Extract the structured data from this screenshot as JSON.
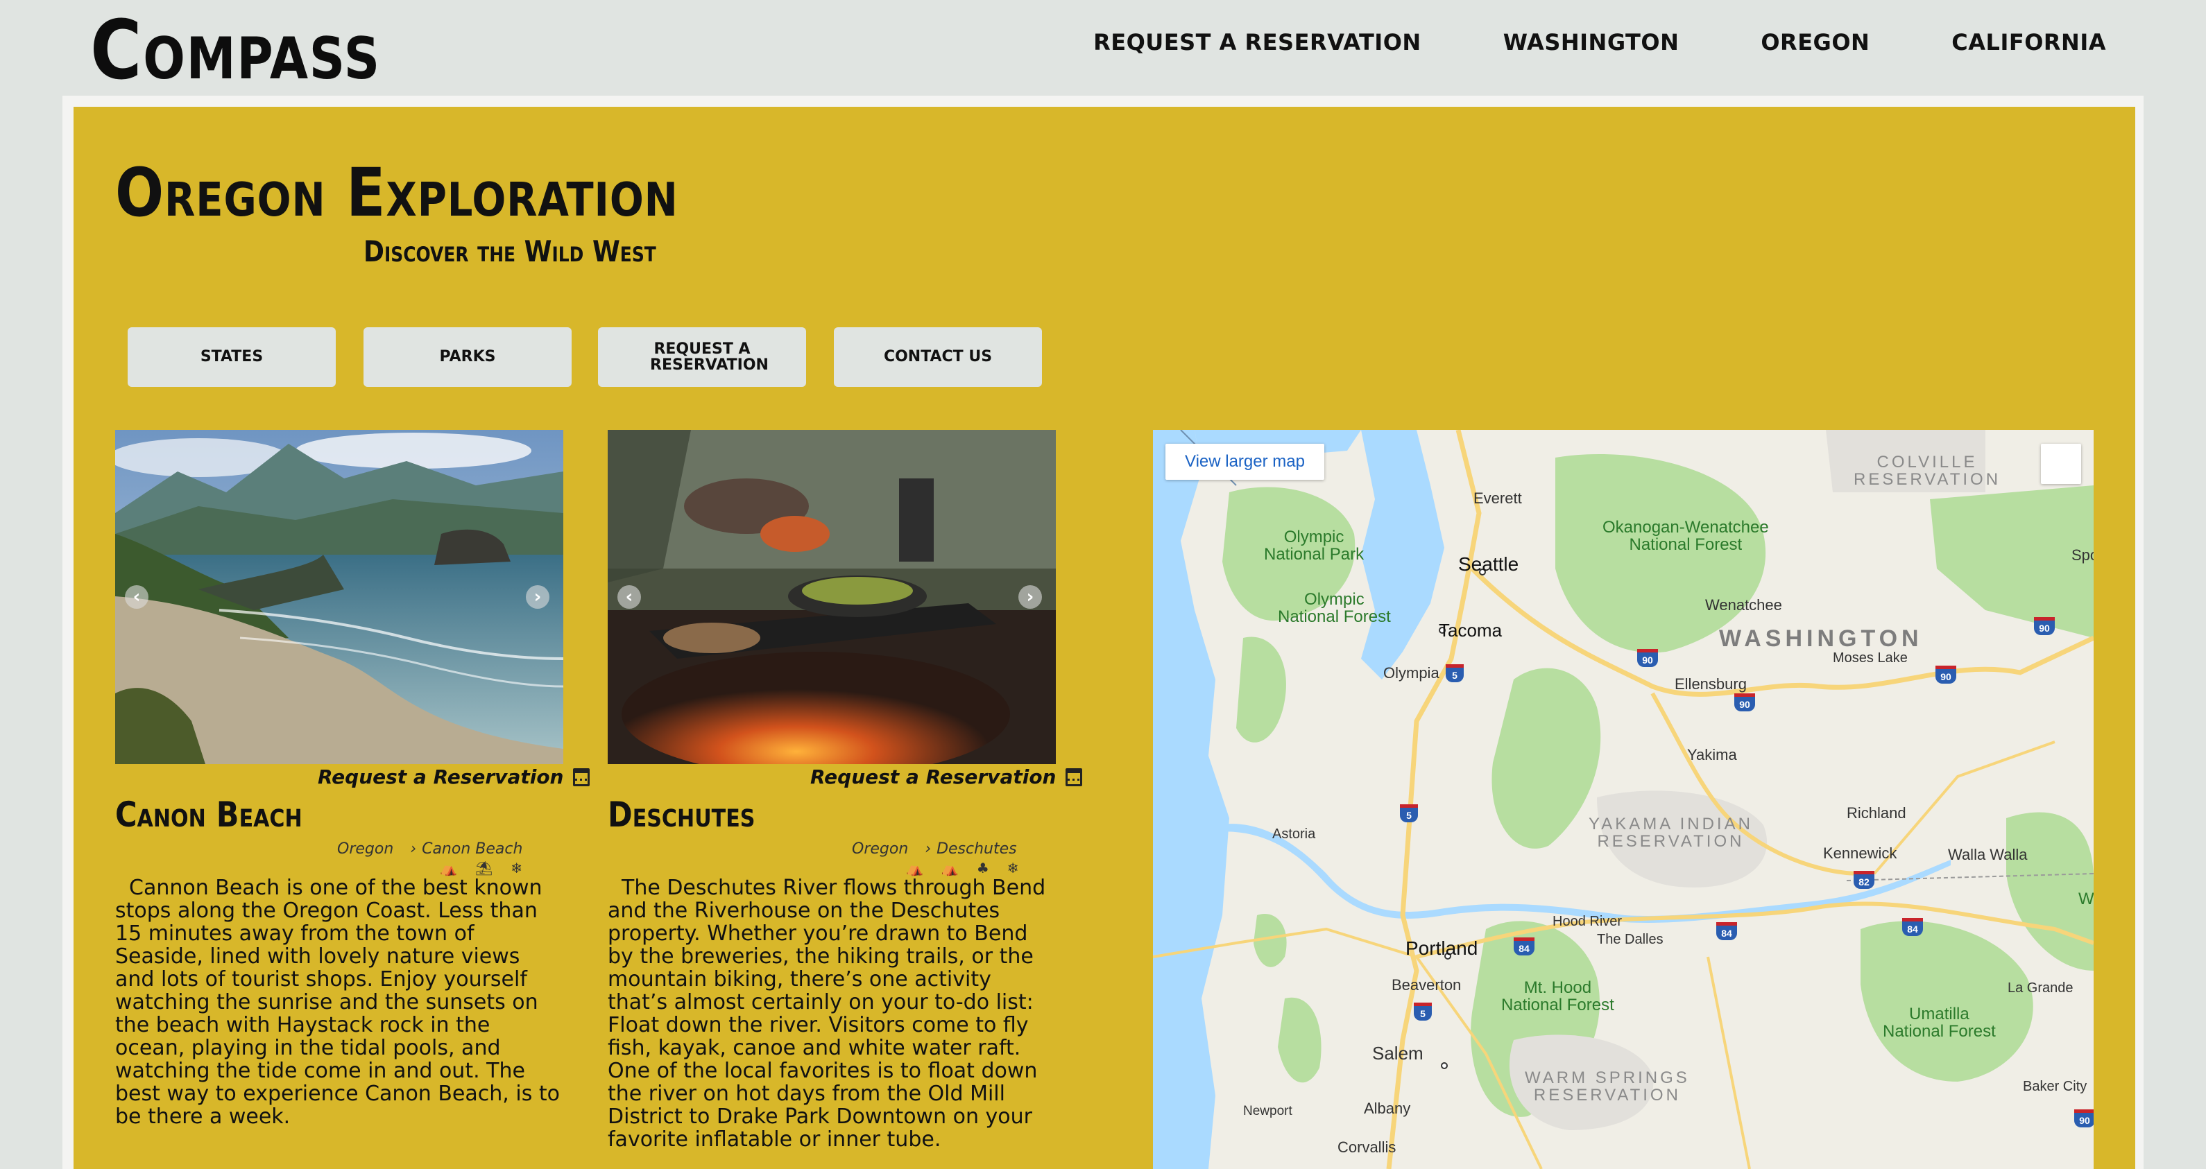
{
  "header": {
    "logo": "Compass",
    "nav": [
      "REQUEST A RESERVATION",
      "WASHINGTON",
      "OREGON",
      "CALIFORNIA"
    ]
  },
  "hero": {
    "title": "Oregon Exploration",
    "subtitle": "Discover the Wild West"
  },
  "buttons": [
    "STATES",
    "PARKS",
    "REQUEST A RESERVATION",
    "CONTACT US"
  ],
  "cards": [
    {
      "reserve_label": "Request a Reservation",
      "title": "Canon Beach",
      "crumb_state": "Oregon",
      "crumb_place": "Canon Beach",
      "amenities": [
        "tent-icon",
        "beach-umbrella-icon",
        "snowflake-icon"
      ],
      "description": "Cannon Beach is one of the best known stops along the Oregon Coast. Less than 15 minutes away from the town of Seaside, lined with lovely nature views and lots of tourist shops. Enjoy yourself watching the sunrise and the sunsets on the beach with Haystack rock in the ocean, playing in the tidal pools, and watching the tide come in and out. The best way to experience Canon Beach, is to be there a week."
    },
    {
      "reserve_label": "Request a Reservation",
      "title": "Deschutes",
      "crumb_state": "Oregon",
      "crumb_place": "Deschutes",
      "amenities": [
        "tent-icon",
        "tent-icon",
        "tree-icon",
        "snowflake-icon"
      ],
      "description": "The Deschutes River flows through Bend and the Riverhouse on the Deschutes property. Whether you’re drawn to Bend by the breweries, the hiking trails, or the mountain biking, there’s one activity that’s almost certainly on your to-do list: Float down the river. Visitors come to fly fish, kayak, canoe and white water raft. One of the local favorites is to float down the river on hot days from the Old Mill District to Drake Park Downtown on your favorite inflatable or inner tube."
    }
  ],
  "map": {
    "view_larger": "View larger map",
    "labels": {
      "everett": "Everett",
      "seattle": "Seattle",
      "tacoma": "Tacoma",
      "olympia": "Olympia",
      "wenatchee": "Wenatchee",
      "moses_lake": "Moses Lake",
      "ellensburg": "Ellensburg",
      "yakima": "Yakima",
      "richland": "Richland",
      "kennewick": "Kennewick",
      "walla_walla": "Walla Walla",
      "astoria": "Astoria",
      "hood_river": "Hood River",
      "the_dalles": "The Dalles",
      "portland": "Portland",
      "beaverton": "Beaverton",
      "salem": "Salem",
      "albany": "Albany",
      "corvallis": "Corvallis",
      "newport": "Newport",
      "la_grande": "La Grande",
      "baker_city": "Baker City",
      "spo": "Spo",
      "w": "W",
      "washington": "WASHINGTON",
      "olympic_np_1": "Olympic",
      "olympic_np_2": "National Park",
      "olympic_nf_1": "Olympic",
      "olympic_nf_2": "National Forest",
      "okanogan_1": "Okanogan-Wenatchee",
      "okanogan_2": "National Forest",
      "mt_hood_1": "Mt. Hood",
      "mt_hood_2": "National Forest",
      "umatilla_1": "Umatilla",
      "umatilla_2": "National Forest",
      "colville_1": "COLVILLE",
      "colville_2": "RESERVATION",
      "yakama_1": "YAKAMA INDIAN",
      "yakama_2": "RESERVATION",
      "warm_springs_1": "WARM SPRINGS",
      "warm_springs_2": "RESERVATION"
    },
    "shields": {
      "i5a": "5",
      "i5b": "5",
      "i5c": "5",
      "i90a": "90",
      "i90b": "90",
      "i90c": "90",
      "i90d": "90",
      "i90e": "90",
      "i82": "82",
      "i84a": "84",
      "i84b": "84",
      "i84c": "84",
      "i84d": "84"
    },
    "colors": {
      "water": "#aadaff",
      "land": "#f0eee6",
      "forest": "#b7dea0",
      "road": "#f7d57a"
    }
  }
}
